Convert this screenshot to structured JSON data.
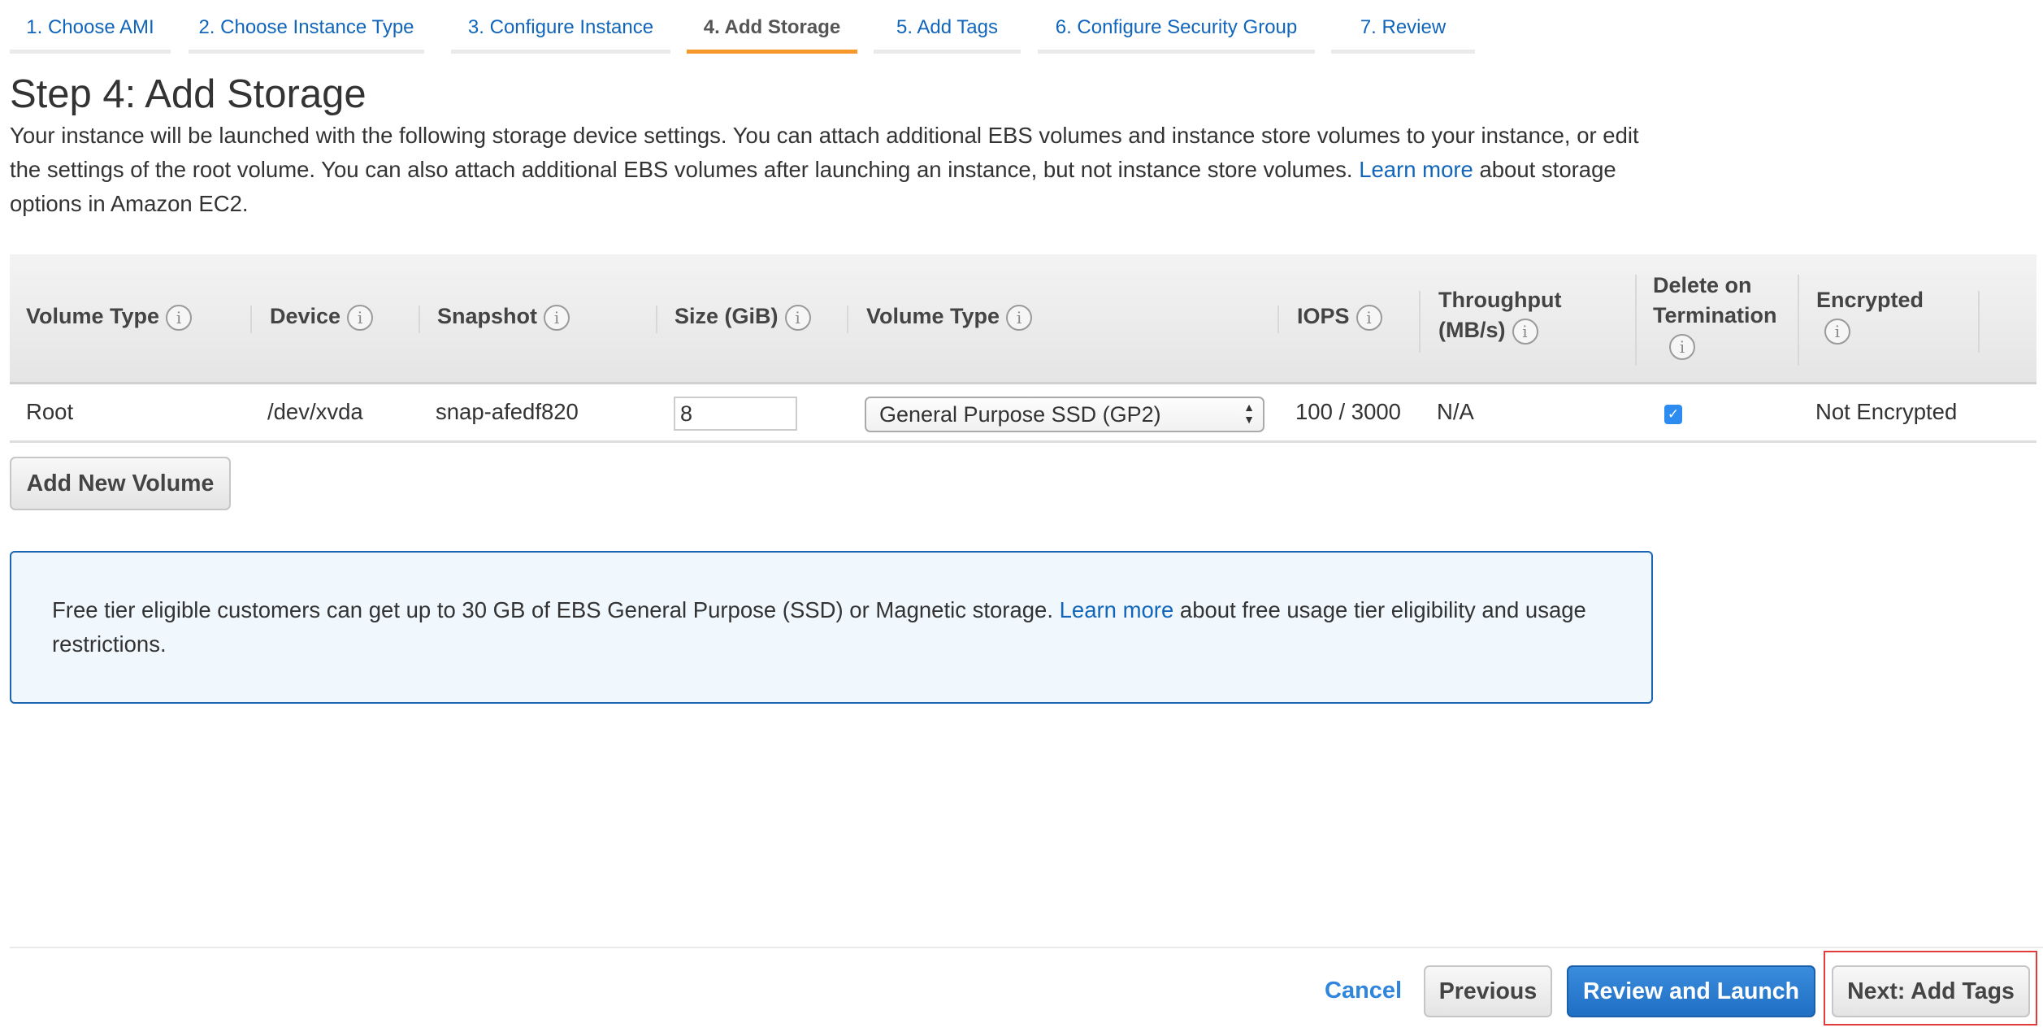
{
  "tabs": [
    {
      "label": "1. Choose AMI",
      "active": false
    },
    {
      "label": "2. Choose Instance Type",
      "active": false
    },
    {
      "label": "3. Configure Instance",
      "active": false
    },
    {
      "label": "4. Add Storage",
      "active": true
    },
    {
      "label": "5. Add Tags",
      "active": false
    },
    {
      "label": "6. Configure Security Group",
      "active": false
    },
    {
      "label": "7. Review",
      "active": false
    }
  ],
  "page": {
    "title": "Step 4: Add Storage",
    "description_part1": "Your instance will be launched with the following storage device settings. You can attach additional EBS volumes and instance store volumes to your instance, or edit the settings of the root volume. You can also attach additional EBS volumes after launching an instance, but not instance store volumes. ",
    "description_link": "Learn more",
    "description_part2": " about storage options in Amazon EC2."
  },
  "table": {
    "columns": [
      {
        "line1": "Volume Type",
        "line2": ""
      },
      {
        "line1": "Device",
        "line2": ""
      },
      {
        "line1": "Snapshot",
        "line2": ""
      },
      {
        "line1": "Size (GiB)",
        "line2": ""
      },
      {
        "line1": "Volume Type",
        "line2": ""
      },
      {
        "line1": "IOPS",
        "line2": ""
      },
      {
        "line1": "Throughput",
        "line2": "(MB/s)"
      },
      {
        "line1": "Delete on",
        "line2": "Termination"
      },
      {
        "line1": "Encrypted",
        "line2": ""
      }
    ],
    "info_glyph": "i",
    "rows": [
      {
        "volume_type": "Root",
        "device": "/dev/xvda",
        "snapshot": "snap-afedf820",
        "size_gib": "8",
        "ebs_volume_type": "General Purpose SSD (GP2)",
        "iops": "100 / 3000",
        "throughput": "N/A",
        "delete_on_termination": true,
        "encrypted": "Not Encrypted"
      }
    ]
  },
  "add_volume_label": "Add New Volume",
  "free_tier": {
    "text_part1": "Free tier eligible customers can get up to 30 GB of EBS General Purpose (SSD) or Magnetic storage. ",
    "link": "Learn more",
    "text_part2": " about free usage tier eligibility and usage restrictions."
  },
  "footer": {
    "cancel": "Cancel",
    "previous": "Previous",
    "review_and_launch": "Review and Launch",
    "next": "Next: Add Tags"
  },
  "icons": {
    "info": "info-circle",
    "checkbox": "checkmark",
    "select_arrows": "up-down-arrows"
  },
  "colors": {
    "link": "#1166bb",
    "active_tab_underline": "#f7982a",
    "primary_button": "#2a7dd1",
    "infobox_border": "#1b65b3",
    "infobox_bg": "#f0f7fd",
    "highlight": "#e23b3b"
  }
}
